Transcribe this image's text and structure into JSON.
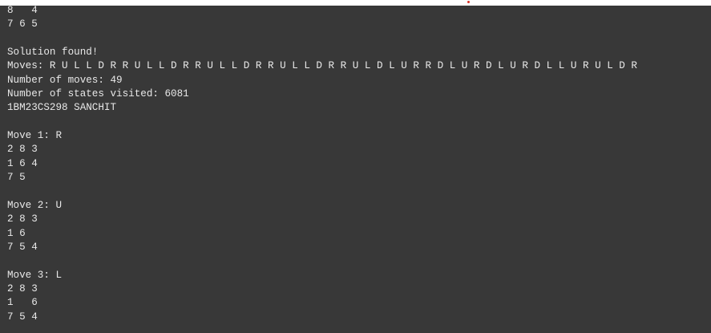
{
  "output": {
    "lines": [
      "8   4",
      "7 6 5",
      "",
      "Solution found!",
      "Moves: R U L L D R R U L L D R R U L L D R R U L L D R R U L D L U R R D L U R D L U R D L L U R U L D R",
      "Number of moves: 49",
      "Number of states visited: 6081",
      "1BM23CS298 SANCHIT",
      "",
      "Move 1: R",
      "2 8 3",
      "1 6 4",
      "7 5",
      "",
      "Move 2: U",
      "2 8 3",
      "1 6",
      "7 5 4",
      "",
      "Move 3: L",
      "2 8 3",
      "1   6",
      "7 5 4"
    ]
  }
}
